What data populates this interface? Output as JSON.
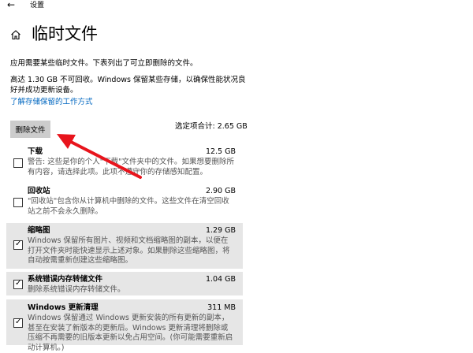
{
  "window": {
    "title": "设置"
  },
  "page": {
    "title": "临时文件"
  },
  "intro": "应用需要某些临时文件。下表列出了可立即删除的文件。",
  "warning": "高达 1.30 GB 不可回收。Windows 保留某些存储，以确保性能状况良好并成功更新设备。",
  "learn_link": "了解存储保留的工作方式",
  "delete_button": "删除文件",
  "total_selected": "选定项合计: 2.65 GB",
  "items": [
    {
      "name": "下载",
      "size": "12.5 GB",
      "checked": false,
      "desc": "警告: 这些是你的个人\"下载\"文件夹中的文件。如果想要删除所有内容，请选择此项。此项不遵守你的存储感知配置。"
    },
    {
      "name": "回收站",
      "size": "2.90 GB",
      "checked": false,
      "desc": "\"回收站\"包含你从计算机中删除的文件。这些文件在清空回收站之前不会永久删除。"
    },
    {
      "name": "缩略图",
      "size": "1.29 GB",
      "checked": true,
      "desc": "Windows 保留所有图片、视频和文档缩略图的副本，以便在打开文件夹时能快速显示上述对象。如果删除这些缩略图，将自动按需重新创建这些缩略图。"
    },
    {
      "name": "系统错误内存转储文件",
      "size": "1.04 GB",
      "checked": true,
      "desc": "删除系统错误内存转储文件。"
    },
    {
      "name": "Windows 更新清理",
      "size": "311 MB",
      "checked": true,
      "desc": "Windows 保留通过 Windows 更新安装的所有更新的副本，甚至在安装了新版本的更新后。Windows 更新清理将删除或压缩不再需要的旧版本更新以免占用空间。(你可能需要重新启动计算机。)"
    }
  ],
  "colors": {
    "link": "#0067c0",
    "selected_bg": "#e6e6e6",
    "arrow": "#e8141c",
    "button": "#cccccc"
  }
}
